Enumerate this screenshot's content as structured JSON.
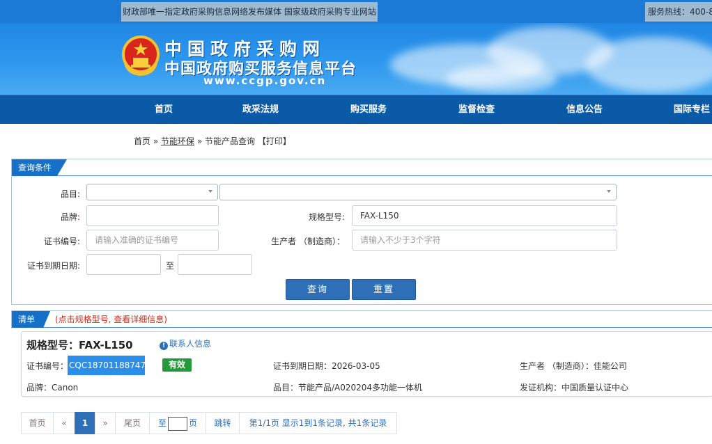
{
  "topbar": {
    "slogan": "财政部唯一指定政府采购信息网络发布媒体 国家级政府采购专业网站",
    "hotline": "服务热线：400-8"
  },
  "banner": {
    "title": "中国政府采购网",
    "subtitle": "中国政府购买服务信息平台",
    "url": "www.ccgp.gov.cn"
  },
  "nav": {
    "items": [
      "首页",
      "政采法规",
      "购买服务",
      "监督检查",
      "信息公告",
      "国际专栏"
    ]
  },
  "breadcrumb": {
    "home": "首页",
    "sep1": "»",
    "section": "节能环保",
    "sep2": "»",
    "current": "节能产品查询",
    "print": "【打印】"
  },
  "query": {
    "tab": "查询条件",
    "category_label": "品目:",
    "brand_label": "品牌:",
    "model_label": "规格型号:",
    "model_value": "FAX-L150",
    "cert_label": "证书编号:",
    "cert_placeholder": "请输入准确的证书编号",
    "maker_label": "生产者 （制造商）：",
    "maker_placeholder": "请输入不少于3个字符",
    "expiry_label": "证书到期日期:",
    "to_label": "至",
    "search_button": "查询",
    "reset_button": "重置"
  },
  "list": {
    "tab": "清单",
    "note": "(点击规格型号, 查看详细信息)"
  },
  "result": {
    "title": "规格型号：FAX-L150",
    "contact_link": "联系人信息",
    "cert_label": "证书编号：",
    "cert_no": "CQC18701188747",
    "status": "有效",
    "expiry": "证书到期日期：2026-03-05",
    "maker": "生产者 （制造商）：佳能公司",
    "brand": "品牌：Canon",
    "category": "品目：节能产品/A020204多功能一体机",
    "issuer": "发证机构：中国质量认证中心"
  },
  "pager": {
    "first": "首页",
    "prev": "«",
    "page": "1",
    "next": "»",
    "last": "尾页",
    "goto_pre": "至",
    "goto_post": "页",
    "jump": "跳转",
    "summary": "第1/1页 显示1到1条记录, 共1条记录"
  },
  "colors": {
    "nav_bg": "#0b5aa8",
    "accent": "#2f6fb7",
    "status_valid": "#259a3b",
    "note_red": "#d0291b"
  }
}
